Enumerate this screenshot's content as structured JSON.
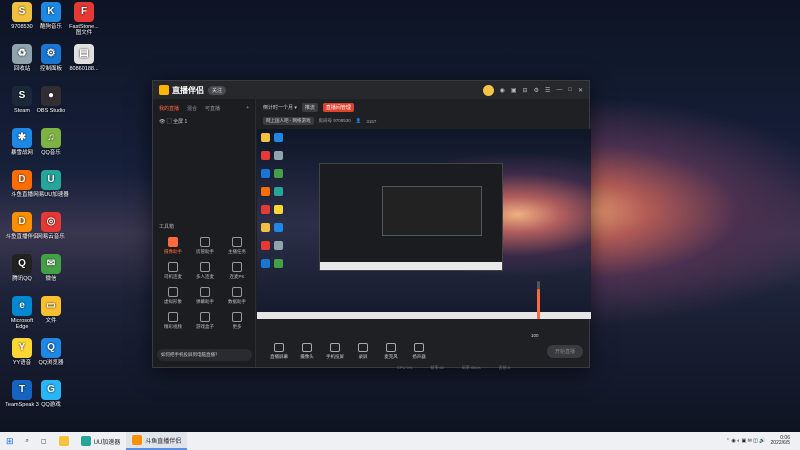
{
  "desktop": {
    "icons": [
      {
        "label": "9708530",
        "color": "#f0c040",
        "glyph": "S"
      },
      {
        "label": "酷狗音乐",
        "color": "#1e88e5",
        "glyph": "K"
      },
      {
        "label": "FastStone... 图文件",
        "color": "#e53935",
        "glyph": "F"
      },
      {
        "label": "回收站",
        "color": "#90a4ae",
        "glyph": "♻"
      },
      {
        "label": "控制面板",
        "color": "#1976d2",
        "glyph": "⚙"
      },
      {
        "label": "80860188...",
        "color": "#e0e0e0",
        "glyph": "▤"
      },
      {
        "label": "Steam",
        "color": "#1b2838",
        "glyph": "S"
      },
      {
        "label": "OBS Studio",
        "color": "#302e31",
        "glyph": "●"
      },
      {
        "label": "暴雪战网",
        "color": "#1e88e5",
        "glyph": "✱"
      },
      {
        "label": "QQ音乐",
        "color": "#7cb342",
        "glyph": "♫"
      },
      {
        "label": "斗鱼直播",
        "color": "#ff6d00",
        "glyph": "D"
      },
      {
        "label": "网易UU加速器",
        "color": "#26a69a",
        "glyph": "U"
      },
      {
        "label": "斗鱼直播伴侣",
        "color": "#ff8f00",
        "glyph": "D"
      },
      {
        "label": "网易云音乐",
        "color": "#e53935",
        "glyph": "◎"
      },
      {
        "label": "腾讯QQ",
        "color": "#212121",
        "glyph": "Q"
      },
      {
        "label": "微信",
        "color": "#43a047",
        "glyph": "✉"
      },
      {
        "label": "Microsoft Edge",
        "color": "#0288d1",
        "glyph": "e"
      },
      {
        "label": "文件",
        "color": "#fbc02d",
        "glyph": "▭"
      },
      {
        "label": "YY语音",
        "color": "#fdd835",
        "glyph": "Y"
      },
      {
        "label": "QQ浏览器",
        "color": "#1e88e5",
        "glyph": "Q"
      },
      {
        "label": "TeamSpeak 3",
        "color": "#1565c0",
        "glyph": "T"
      },
      {
        "label": "QQ游戏",
        "color": "#29b6f6",
        "glyph": "G"
      }
    ]
  },
  "window": {
    "title": "直播伴侣",
    "badge": "关注",
    "title_controls": [
      "◉",
      "▣",
      "⊟",
      "⚙",
      "☰",
      "—",
      "□",
      "✕"
    ],
    "left": {
      "tabs": [
        "我的直播",
        "混合",
        "可直播"
      ],
      "add": "+",
      "scene": "全屏 1",
      "tools_title": "工具箱",
      "tools": [
        {
          "label": "摄像助手",
          "hot": true
        },
        {
          "label": "房管助手",
          "hot": false
        },
        {
          "label": "主播任务",
          "hot": false
        },
        {
          "label": "司机连麦",
          "hot": false
        },
        {
          "label": "多人连麦",
          "hot": false
        },
        {
          "label": "连麦PK",
          "hot": false
        },
        {
          "label": "虚拟形象",
          "hot": false
        },
        {
          "label": "弹幕助手",
          "hot": false
        },
        {
          "label": "数据助手",
          "hot": false
        },
        {
          "label": "精彩视频",
          "hot": false
        },
        {
          "label": "游戏盒子",
          "hot": false
        },
        {
          "label": "更多",
          "hot": false
        }
      ],
      "notice": "如何把手机投屏到电脑直播？"
    },
    "right": {
      "timer": "倒计时一个月 ▾",
      "btn1": "推流",
      "btn2": "直播间管理",
      "room_tag": "网上国人吧 - 网络游戏",
      "room_id": "房间号 9708530",
      "viewers": "3157",
      "toolbar": [
        "直播屏幕",
        "摄像头",
        "手机投屏",
        "录屏",
        "麦克风",
        "扬声器"
      ],
      "start": "开始直播",
      "slider_value": "100",
      "slider_fraction": 0.78,
      "status": [
        "CPU 0%",
        "帧率:60",
        "码率:0kb/s",
        "丢帧:0"
      ]
    }
  },
  "taskbar": {
    "items": [
      {
        "label": "UU加速器",
        "color": "#26a69a",
        "active": false
      },
      {
        "label": "斗鱼直播伴侣",
        "color": "#ff8f00",
        "active": true
      }
    ],
    "time": "0:06",
    "date": "2022/6/5"
  }
}
